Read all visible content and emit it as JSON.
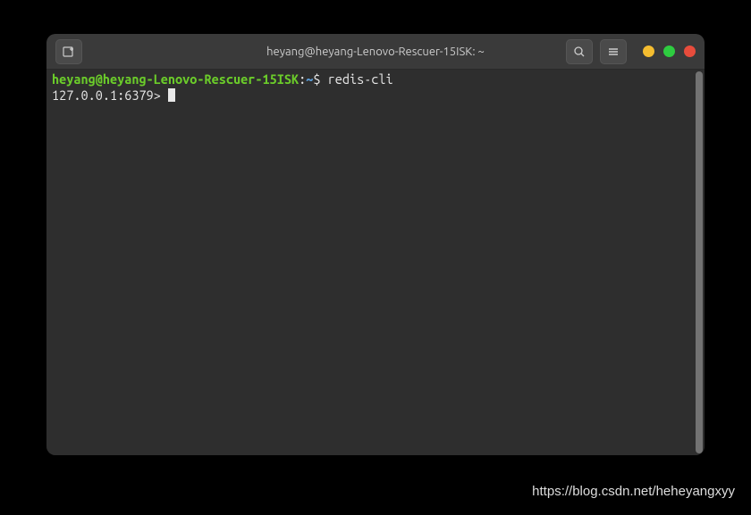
{
  "titlebar": {
    "title": "heyang@heyang-Lenovo-Rescuer-15ISK: ~"
  },
  "terminal": {
    "prompt_userhost": "heyang@heyang-Lenovo-Rescuer-15ISK",
    "prompt_colon": ":",
    "prompt_path": "~",
    "prompt_dollar": "$",
    "command": "redis-cli",
    "redis_prompt": "127.0.0.1:6379>"
  },
  "watermark": "https://blog.csdn.net/heheyangxyy"
}
